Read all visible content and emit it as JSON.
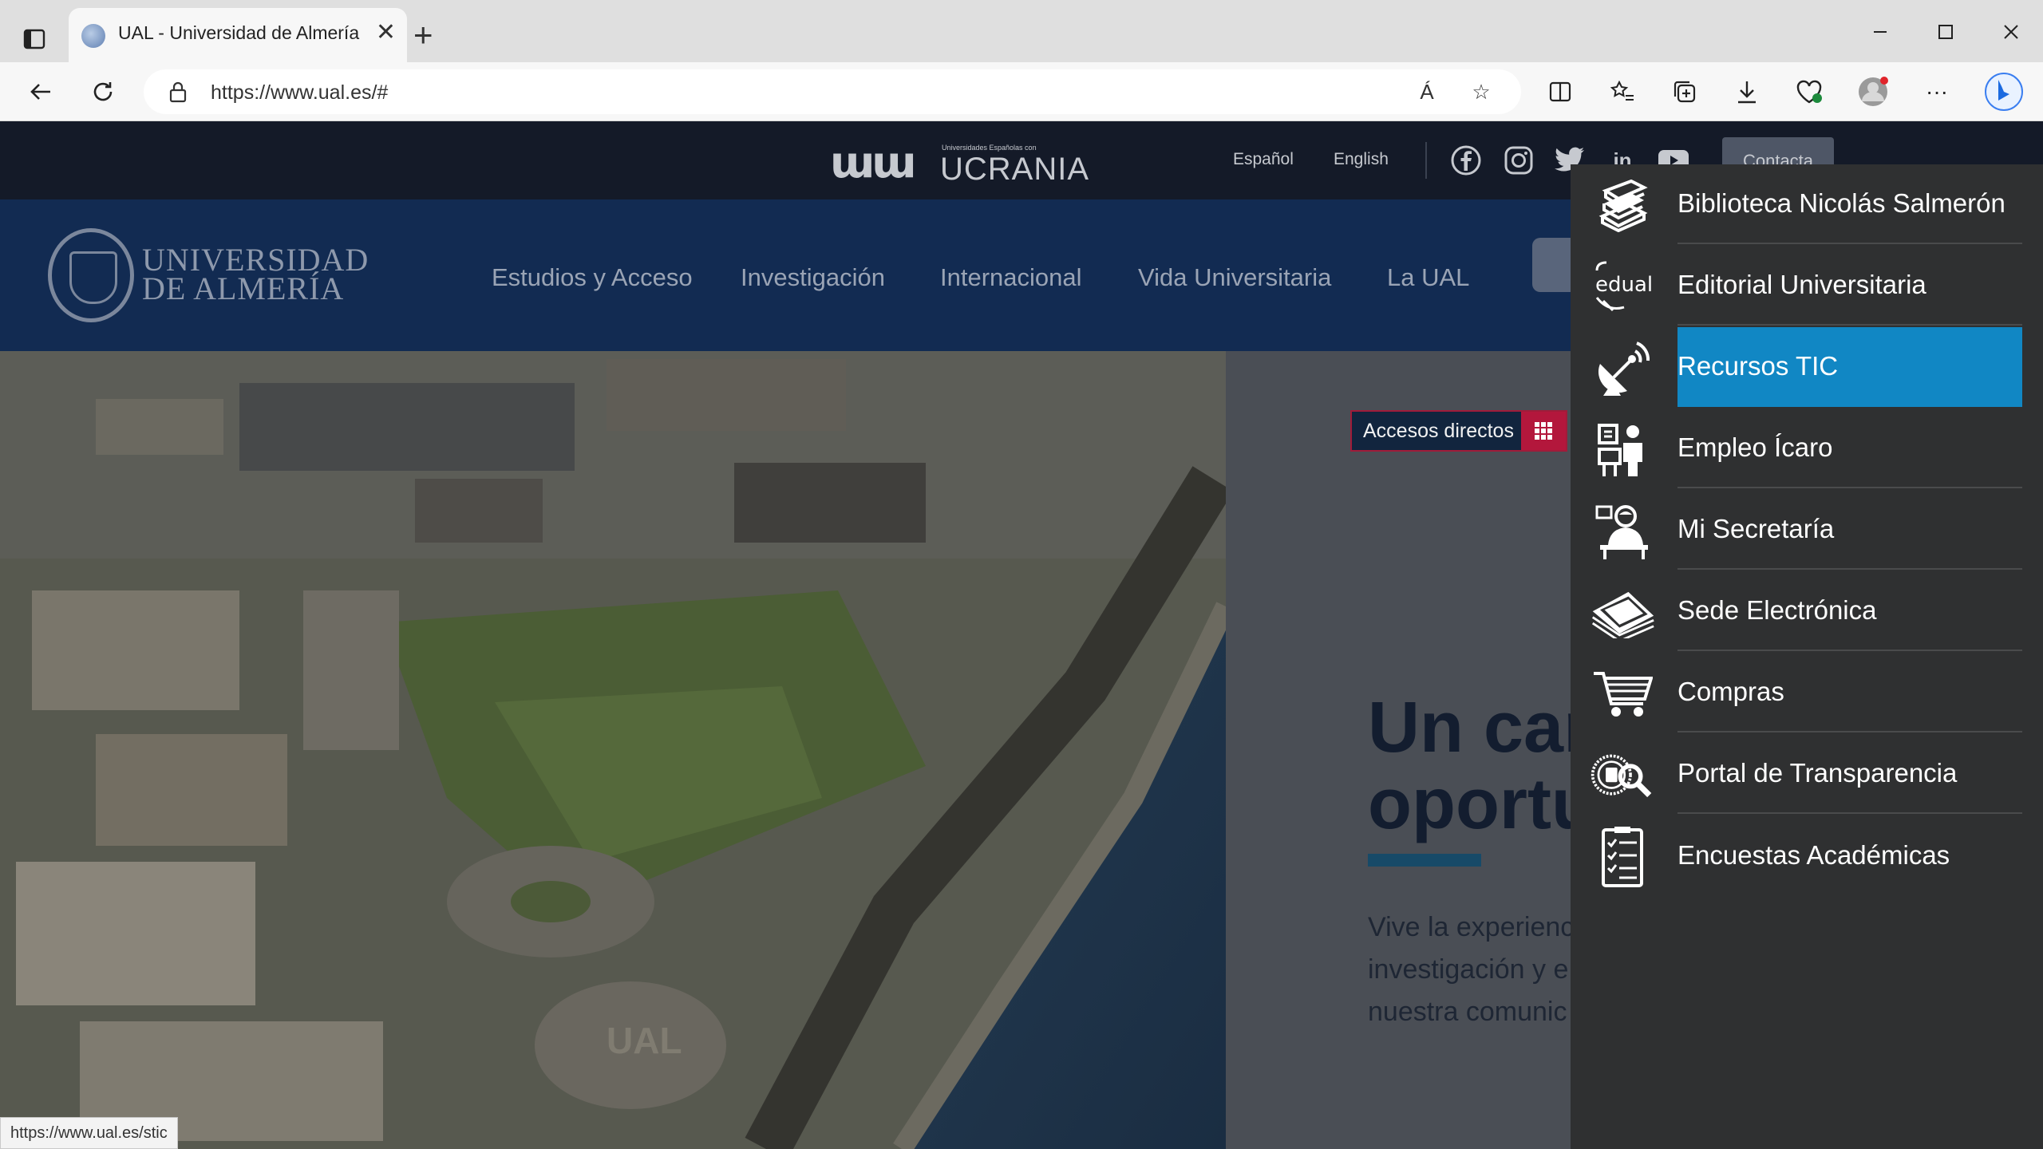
{
  "browser": {
    "tab_title": "UAL - Universidad de Almería",
    "url": "https://www.ual.es/#",
    "read_aloud_label": "Á"
  },
  "site": {
    "banner_small_text": "Universidades Españolas con",
    "banner_title": "UCRANIA",
    "languages": [
      "Español",
      "English"
    ],
    "contact_label": "Contacta",
    "logo_line1": "UNIVERSIDAD",
    "logo_line2": "DE ALMERÍA",
    "nav": [
      "Estudios y Acceso",
      "Investigación",
      "Internacional",
      "Vida Universitaria",
      "La UAL"
    ],
    "accesos_label": "Accesos directos",
    "hero_title_line1": "Un car",
    "hero_title_line2": "oportu",
    "hero_text": [
      "Vive la experienc",
      "investigación y e",
      "nuestra comunic"
    ],
    "campus_sign": "UAL"
  },
  "panel": {
    "items": [
      {
        "label": "Biblioteca Nicolás Salmerón",
        "icon": "books-icon",
        "active": false
      },
      {
        "label": "Editorial Universitaria",
        "icon": "edual-icon",
        "active": false
      },
      {
        "label": "Recursos TIC",
        "icon": "satellite-dish-icon",
        "active": true
      },
      {
        "label": "Empleo Ícaro",
        "icon": "job-icon",
        "active": false
      },
      {
        "label": "Mi Secretaría",
        "icon": "secretary-icon",
        "active": false
      },
      {
        "label": "Sede Electrónica",
        "icon": "documents-icon",
        "active": false
      },
      {
        "label": "Compras",
        "icon": "cart-icon",
        "active": false
      },
      {
        "label": "Portal de Transparencia",
        "icon": "seal-search-icon",
        "active": false
      },
      {
        "label": "Encuestas Académicas",
        "icon": "clipboard-icon",
        "active": false
      }
    ],
    "edual_text": "edual"
  },
  "status_bar": {
    "hover_url": "https://www.ual.es/stic"
  },
  "colors": {
    "panel_bg": "#2f3031",
    "active_item": "#1187c4",
    "accesos_grid": "#b3173c",
    "nav_bg": "#122b52"
  }
}
